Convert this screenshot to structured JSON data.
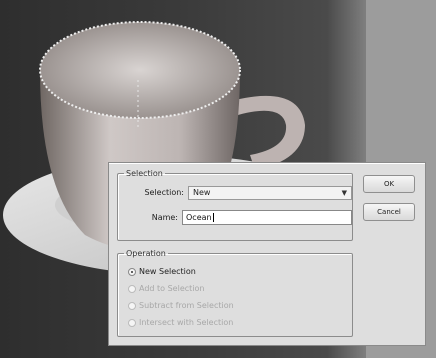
{
  "dialog": {
    "selection_group": {
      "legend": "Selection",
      "selection_label": "Selection:",
      "selection_value": "New",
      "name_label": "Name:",
      "name_value": "Ocean"
    },
    "operation_group": {
      "legend": "Operation",
      "options": [
        {
          "label": "New Selection",
          "checked": true,
          "enabled": true
        },
        {
          "label": "Add to Selection",
          "checked": false,
          "enabled": false
        },
        {
          "label": "Subtract from Selection",
          "checked": false,
          "enabled": false
        },
        {
          "label": "Intersect with Selection",
          "checked": false,
          "enabled": false
        }
      ]
    },
    "buttons": {
      "ok": "OK",
      "cancel": "Cancel"
    }
  },
  "icons": [
    "chevron-down-icon",
    "radio-icon"
  ]
}
